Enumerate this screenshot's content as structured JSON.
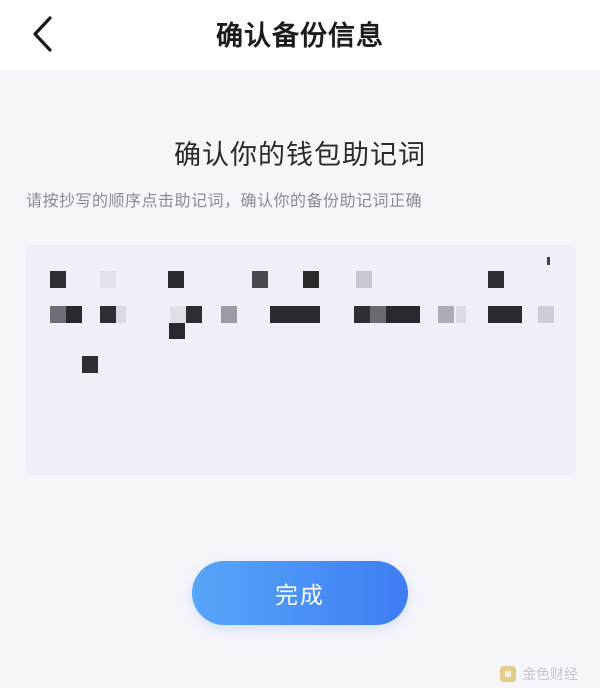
{
  "header": {
    "title": "确认备份信息",
    "back_icon": "chevron-left-icon"
  },
  "main": {
    "heading": "确认你的钱包助记词",
    "hint": "请按抄写的顺序点击助记词，确认你的备份助记词正确",
    "words_state": "obscured (pixelated)"
  },
  "done_button": {
    "label": "完成",
    "gradient_start": "#57a6f9",
    "gradient_end": "#3e7df3"
  },
  "watermark": {
    "text": "金色财经"
  },
  "colors": {
    "background": "#f6f5fa",
    "words_box": "#f0eef6",
    "title_text": "#1c1c1c"
  }
}
